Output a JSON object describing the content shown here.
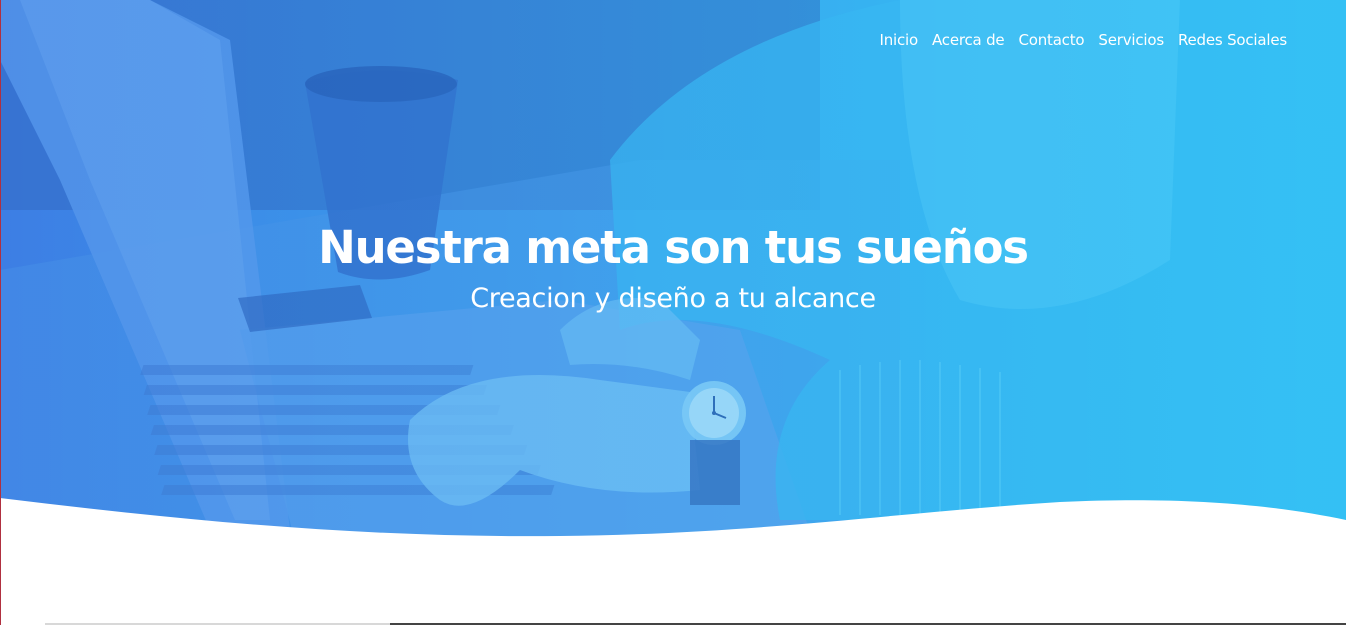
{
  "nav": {
    "items": [
      {
        "label": "Inicio"
      },
      {
        "label": "Acerca de"
      },
      {
        "label": "Contacto"
      },
      {
        "label": "Servicios"
      },
      {
        "label": "Redes Sociales"
      }
    ]
  },
  "hero": {
    "title": "Nuestra meta son tus sueños",
    "subtitle": "Creacion y diseño a tu alcance",
    "background_icon": "laptop-typing-photo",
    "overlay_colors": [
      "#3d7fe6",
      "#2fc9f5"
    ]
  }
}
